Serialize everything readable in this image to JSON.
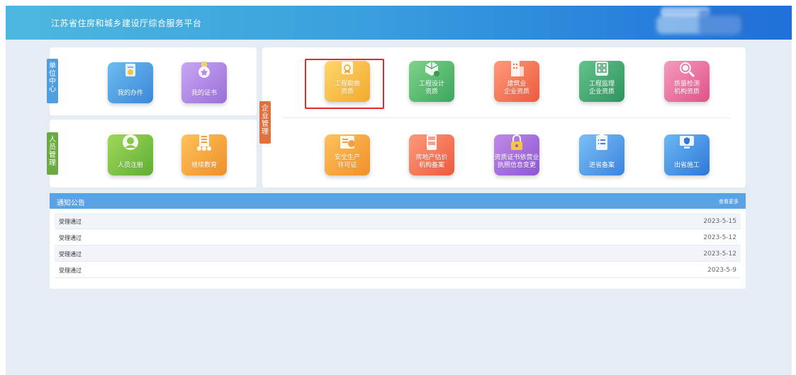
{
  "header": {
    "title": "江苏省住房和城乡建设厅综合服务平台"
  },
  "unit_panel": {
    "tab_label": "单位中心",
    "tiles": [
      {
        "label": "我的办件",
        "icon": "document-bell-icon"
      },
      {
        "label": "我的证书",
        "icon": "certificate-badge-icon"
      }
    ]
  },
  "staff_panel": {
    "tab_label": "人员管理",
    "tiles": [
      {
        "label": "人员注册",
        "icon": "user-avatar-icon"
      },
      {
        "label": "继续教育",
        "icon": "building-people-icon"
      }
    ]
  },
  "company_panel": {
    "tab_label": "企业管理",
    "row1": [
      {
        "label": "工程勘察\n资质",
        "icon": "survey-badge-icon"
      },
      {
        "label": "工程设计\n资质",
        "icon": "design-cube-icon"
      },
      {
        "label": "建筑业\n企业资质",
        "icon": "building-icon"
      },
      {
        "label": "工程监理\n企业资质",
        "icon": "supervision-grid-icon"
      },
      {
        "label": "质量检测\n机构资质",
        "icon": "magnifier-icon"
      }
    ],
    "row2": [
      {
        "label": "安全生产\n许可证",
        "icon": "safety-folder-icon"
      },
      {
        "label": "房地产估价\n机构备案",
        "icon": "file-cabinet-icon"
      },
      {
        "label": "资质证书依营业\n执照信息变更",
        "icon": "lock-certificate-icon"
      },
      {
        "label": "进省备案",
        "icon": "clipboard-list-icon"
      },
      {
        "label": "出省施工",
        "icon": "monitor-shield-icon"
      }
    ]
  },
  "notices": {
    "title": "通知公告",
    "more_label": "查看更多",
    "items": [
      {
        "text": "受理通过",
        "date": "2023-5-15"
      },
      {
        "text": "受理通过",
        "date": "2023-5-12"
      },
      {
        "text": "受理通过",
        "date": "2023-5-12"
      },
      {
        "text": "受理通过",
        "date": "2023-5-9"
      }
    ]
  },
  "colors": {
    "header_start": "#4db8df",
    "header_end": "#1f6fd9",
    "highlight_border": "#e42828",
    "notice_bar": "#5aa2e6"
  }
}
